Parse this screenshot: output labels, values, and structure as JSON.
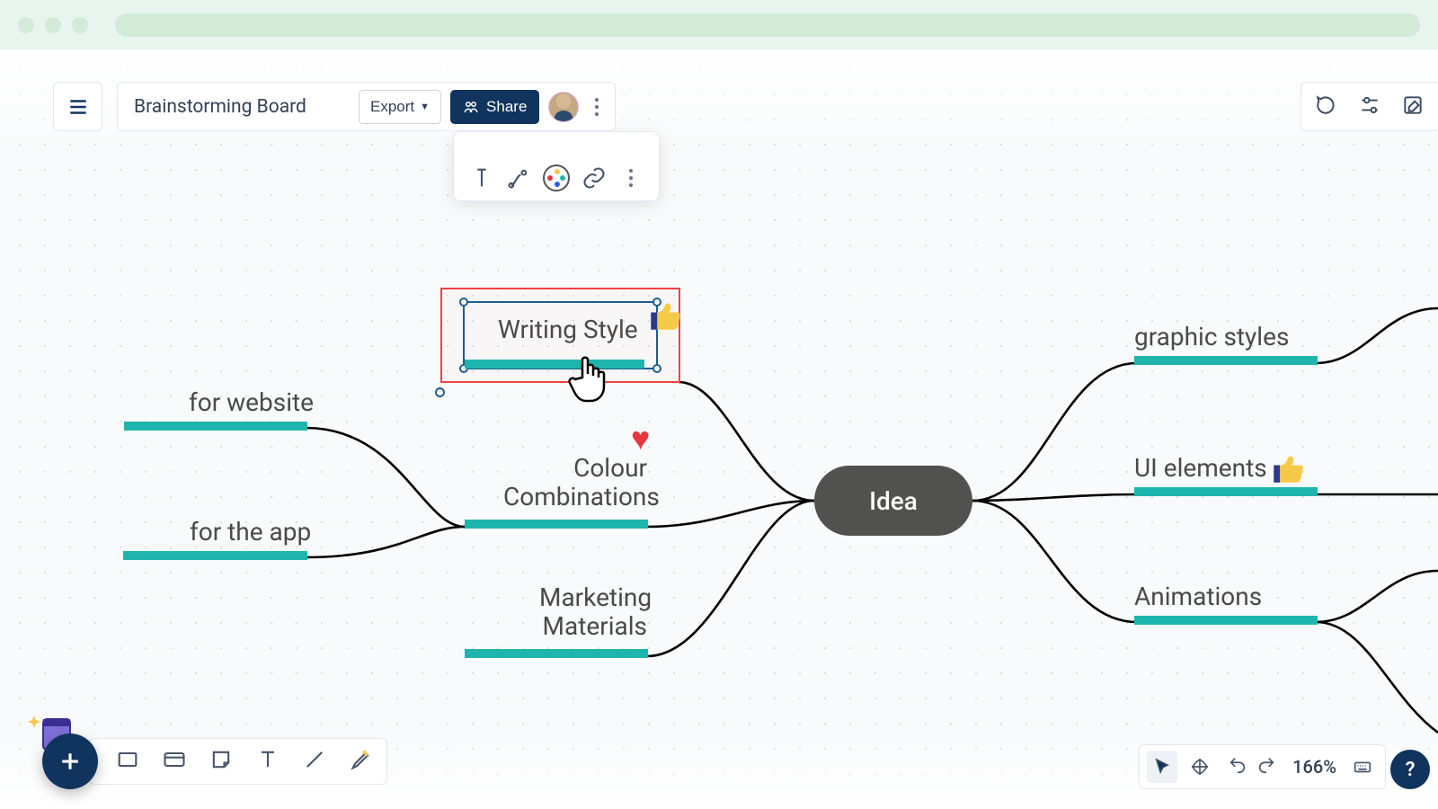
{
  "board": {
    "title": "Brainstorming Board"
  },
  "toolbar": {
    "export_label": "Export",
    "share_label": "Share"
  },
  "central_node": {
    "label": "Idea"
  },
  "nodes": {
    "writing_style": "Writing Style",
    "colour_combinations": "Colour\nCombinations",
    "marketing_materials": "Marketing\nMaterials",
    "for_website": "for website",
    "for_the_app": "for the app",
    "graphic_styles": "graphic styles",
    "ui_elements": "UI elements",
    "animations": "Animations"
  },
  "reactions": {
    "writing_style_emoji": "thumbs-up",
    "colour_combinations_emoji": "heart",
    "ui_elements_emoji": "thumbs-up"
  },
  "zoom": {
    "level": "166%"
  },
  "help": {
    "label": "?"
  },
  "colors": {
    "accent_teal": "#20b5ac",
    "primary_navy": "#10345e",
    "selection_red": "#ef4444",
    "node_grey": "#51514f"
  }
}
